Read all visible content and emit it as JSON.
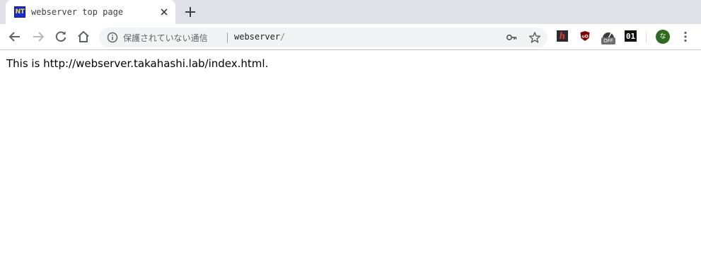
{
  "tab": {
    "favicon_text": "NT",
    "title": "webserver top page",
    "close_icon": "close-icon"
  },
  "new_tab_icon": "plus-icon",
  "toolbar": {
    "back_icon": "arrow-left-icon",
    "forward_icon": "arrow-right-icon",
    "reload_icon": "reload-icon",
    "home_icon": "home-icon"
  },
  "omnibox": {
    "security_text": "保護されていない通信",
    "host": "webserver",
    "path": "/",
    "key_icon": "key-icon",
    "star_icon": "star-icon"
  },
  "extensions": {
    "h_label": "h",
    "ublock_label": "uO",
    "gauge_off_label": "OFF",
    "binary_label": "01"
  },
  "profile": {
    "avatar_text": "な",
    "avatar_color": "#2e6b1f"
  },
  "colors": {
    "tabstrip_bg": "#dee1e6",
    "omnibox_bg": "#f1f3f4",
    "favicon_bg": "#1a2ad8",
    "favicon_fg": "#f3e21b"
  },
  "page": {
    "body_text": "This is http://webserver.takahashi.lab/index.html."
  }
}
